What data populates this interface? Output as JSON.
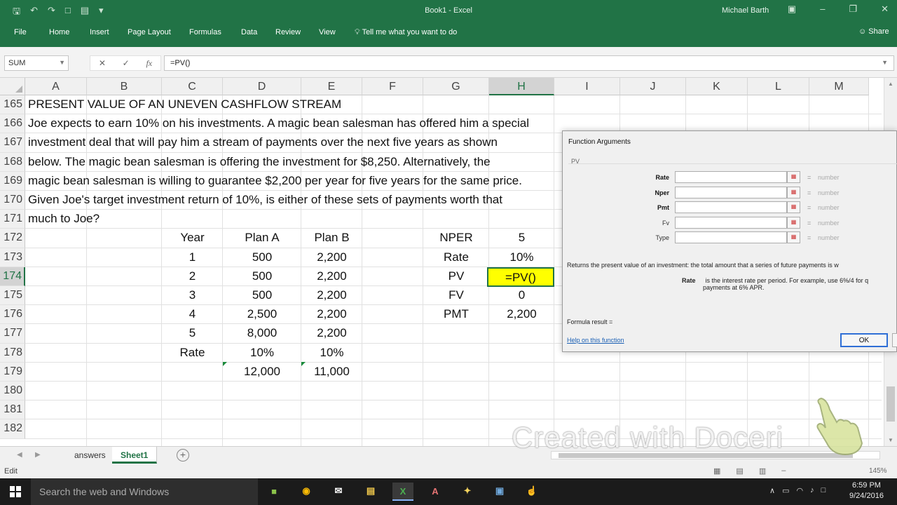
{
  "window": {
    "title": "Book1 - Excel",
    "user": "Michael Barth",
    "qat_icons": [
      "save-icon",
      "undo-icon",
      "redo-icon",
      "new-file-icon",
      "open-folder-icon",
      "customize-qat-icon"
    ]
  },
  "ribbon": {
    "tabs": [
      "File",
      "Home",
      "Insert",
      "Page Layout",
      "Formulas",
      "Data",
      "Review",
      "View"
    ],
    "tell_me": "Tell me what you want to do",
    "share": "Share"
  },
  "formula_bar": {
    "name_box": "SUM",
    "formula": "=PV()"
  },
  "grid": {
    "columns": [
      "A",
      "B",
      "C",
      "D",
      "E",
      "F",
      "G",
      "H",
      "I",
      "J",
      "K",
      "L",
      "M"
    ],
    "selected_column": "H",
    "rows": [
      "165",
      "166",
      "167",
      "168",
      "169",
      "170",
      "171",
      "172",
      "173",
      "174",
      "175",
      "176",
      "177",
      "178",
      "179",
      "180",
      "181",
      "182"
    ],
    "selected_row": "174",
    "text_lines": [
      "PRESENT VALUE OF AN UNEVEN CASHFLOW STREAM",
      "Joe expects to earn 10% on his investments. A magic bean salesman has offered him a special",
      "investment deal that will pay him a stream of payments over the next five years as shown",
      "below. The magic bean salesman is offering the investment for $8,250. Alternatively, the",
      "magic bean salesman is willing to guarantee $2,200 per year for five years for the same price.",
      "Given Joe's target investment return of 10%, is either of these sets of payments worth that",
      "much to Joe?"
    ],
    "plan_table": {
      "headers": [
        "Year",
        "Plan A",
        "Plan B"
      ],
      "rows": [
        [
          "1",
          "500",
          "2,200"
        ],
        [
          "2",
          "500",
          "2,200"
        ],
        [
          "3",
          "500",
          "2,200"
        ],
        [
          "4",
          "2,500",
          "2,200"
        ],
        [
          "5",
          "8,000",
          "2,200"
        ],
        [
          "Rate",
          "10%",
          "10%"
        ],
        [
          "",
          "12,000",
          "11,000"
        ]
      ]
    },
    "params": [
      {
        "label": "NPER",
        "value": "5"
      },
      {
        "label": "Rate",
        "value": "10%"
      },
      {
        "label": "PV",
        "value": "=PV()"
      },
      {
        "label": "FV",
        "value": "0"
      },
      {
        "label": "PMT",
        "value": "2,200"
      }
    ]
  },
  "sheets": {
    "tabs": [
      "answers",
      "Sheet1"
    ],
    "active": "Sheet1"
  },
  "status": {
    "mode": "Edit",
    "zoom": "145%"
  },
  "dialog": {
    "title": "Function Arguments",
    "function": "PV",
    "args": [
      {
        "label": "Rate",
        "hint": "number",
        "bold": true
      },
      {
        "label": "Nper",
        "hint": "number",
        "bold": true
      },
      {
        "label": "Pmt",
        "hint": "number",
        "bold": true
      },
      {
        "label": "Fv",
        "hint": "number",
        "bold": false
      },
      {
        "label": "Type",
        "hint": "number",
        "bold": false
      }
    ],
    "equals": "=",
    "description": "Returns the present value of an investment: the total amount that a series of future payments is w",
    "arg_name": "Rate",
    "arg_desc_1": "is the interest rate per period. For example, use 6%/4 for q",
    "arg_desc_2": "payments at 6% APR.",
    "formula_result": "Formula result =",
    "help_link": "Help on this function",
    "ok": "OK"
  },
  "watermark": "Created with Doceri",
  "taskbar": {
    "search": "Search the web and Windows",
    "time": "6:59 PM",
    "date": "9/24/2016"
  }
}
